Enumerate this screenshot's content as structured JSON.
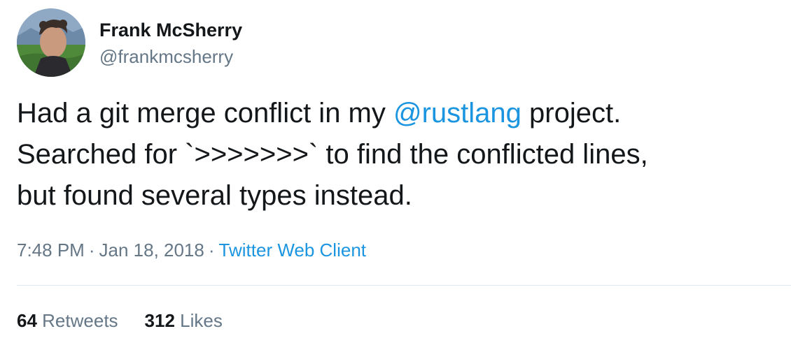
{
  "author": {
    "name": "Frank McSherry",
    "handle": "@frankmcsherry"
  },
  "tweet": {
    "line1_before": "Had a git merge conflict in my ",
    "line1_mention": "@rustlang",
    "line1_after": " project.",
    "line2": "Searched for `>>>>>>>` to find the conflicted lines,",
    "line3": "but found several types instead."
  },
  "meta": {
    "time": "7:48 PM",
    "date": "Jan 18, 2018",
    "separator": "·",
    "source": "Twitter Web Client"
  },
  "stats": {
    "retweets_count": "64",
    "retweets_label": "Retweets",
    "likes_count": "312",
    "likes_label": "Likes"
  },
  "colors": {
    "text": "#14171a",
    "secondary": "#657786",
    "link": "#1b95e0",
    "divider": "#e1e8ed"
  }
}
